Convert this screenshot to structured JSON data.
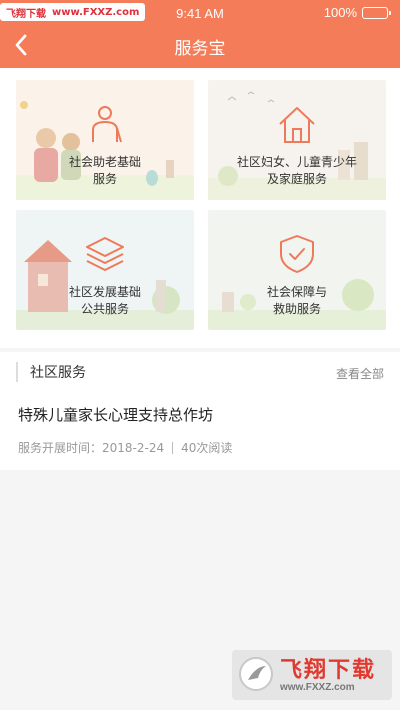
{
  "status_bar": {
    "site_brand": "飞翔下载",
    "site_url": "www.FXXZ.com",
    "time": "9:41 AM",
    "battery": "100%"
  },
  "header": {
    "title": "服务宝"
  },
  "services": [
    {
      "label": "社会助老基础\n服务",
      "icon": "elder-care-icon"
    },
    {
      "label": "社区妇女、儿童青少年\n及家庭服务",
      "icon": "home-icon"
    },
    {
      "label": "社区发展基础\n公共服务",
      "icon": "layers-icon"
    },
    {
      "label": "社会保障与\n救助服务",
      "icon": "shield-check-icon"
    }
  ],
  "community": {
    "title": "社区服务",
    "more": "查看全部",
    "article": {
      "title": "特殊儿童家长心理支持总作坊",
      "date": "服务开展时间：2018-2-24",
      "reads": "40次阅读"
    }
  },
  "watermark": {
    "text": "飞翔下载",
    "url": "www.FXXZ.com"
  },
  "colors": {
    "accent": "#f47c59",
    "icon_stroke": "#ef7a5a"
  }
}
